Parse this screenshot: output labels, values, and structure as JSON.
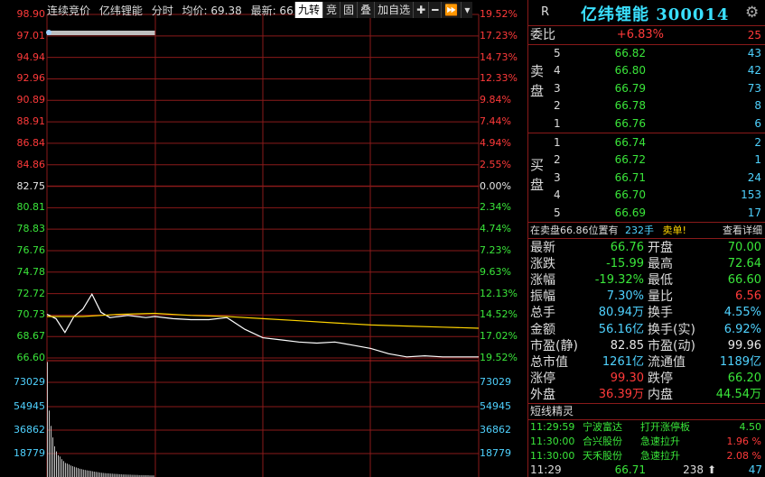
{
  "header": {
    "items": [
      "连续竞价",
      "亿纬锂能",
      "分时",
      "均价: 69.38",
      "最新: 66"
    ],
    "toolbar": [
      "九转",
      "竞",
      "固",
      "叠",
      "加自选",
      "✚",
      "━",
      "⏩",
      "▾"
    ]
  },
  "axis": {
    "left_price": [
      "98.90",
      "97.01",
      "94.94",
      "92.96",
      "90.89",
      "88.91",
      "86.84",
      "84.86",
      "82.75",
      "80.81",
      "78.83",
      "76.76",
      "74.78",
      "72.72",
      "70.73",
      "68.67",
      "66.60"
    ],
    "right_pct": [
      "19.52%",
      "17.23%",
      "14.73%",
      "12.33%",
      "9.84%",
      "7.44%",
      "4.94%",
      "2.55%",
      "0.00%",
      "2.34%",
      "4.74%",
      "7.23%",
      "9.63%",
      "12.13%",
      "14.52%",
      "17.02%",
      "19.52%"
    ],
    "volume": [
      "73029",
      "54945",
      "36862",
      "18779"
    ]
  },
  "chart_data": {
    "type": "line",
    "prev_close": 82.75,
    "ylim": [
      66.6,
      98.9
    ],
    "x_range_minutes": [
      0,
      240
    ],
    "series": [
      {
        "values_minute": [
          0,
          5,
          10,
          15,
          20,
          25,
          30,
          35,
          40,
          45,
          50,
          55,
          60,
          70,
          80,
          90,
          100,
          110,
          120,
          130,
          140,
          150,
          160,
          170,
          180,
          190,
          200,
          210,
          220,
          230,
          240
        ],
        "values": [
          70.7,
          70.3,
          69.0,
          70.5,
          71.2,
          72.6,
          70.9,
          70.4,
          70.5,
          70.6,
          70.5,
          70.4,
          70.5,
          70.3,
          70.2,
          70.2,
          70.4,
          69.3,
          68.5,
          68.3,
          68.1,
          68.0,
          68.1,
          67.8,
          67.5,
          67.0,
          66.7,
          66.8,
          66.7,
          66.7,
          66.7
        ]
      },
      {
        "values_minute": [
          0,
          20,
          40,
          60,
          80,
          100,
          120,
          140,
          160,
          180,
          200,
          220,
          240
        ],
        "values": [
          70.5,
          70.5,
          70.7,
          70.8,
          70.6,
          70.5,
          70.3,
          70.1,
          69.9,
          69.7,
          69.6,
          69.5,
          69.4
        ]
      }
    ],
    "volume_ylim": [
      0,
      91000
    ],
    "volume_bars": [
      90000,
      52000,
      40000,
      31000,
      24000,
      20000,
      17000,
      16000,
      14000,
      12500,
      11000,
      10500,
      9800,
      9000,
      8500,
      8000,
      7500,
      7000,
      6500,
      6200,
      5800,
      5500,
      5200,
      5000,
      4800,
      4500,
      4200,
      4000,
      3800,
      3500,
      3300,
      3200,
      3000,
      2900,
      2800,
      2700,
      2600,
      2500,
      2400,
      2300,
      2200,
      2100,
      2000,
      2000,
      1900,
      1800,
      1800,
      1700,
      1700,
      1600,
      1600,
      1500,
      1500,
      1500,
      1400,
      1400,
      1400,
      1300,
      1300,
      1300
    ]
  },
  "quote": {
    "r": "R",
    "title": "亿纬锂能 300014",
    "weibi": {
      "label": "委比",
      "pct": "+6.83%",
      "vol": "25"
    },
    "sell_label": [
      "卖",
      "盘"
    ],
    "buy_label": [
      "买",
      "盘"
    ],
    "sell": [
      {
        "lvl": "5",
        "price": "66.82",
        "vol": "43"
      },
      {
        "lvl": "4",
        "price": "66.80",
        "vol": "42"
      },
      {
        "lvl": "3",
        "price": "66.79",
        "vol": "73"
      },
      {
        "lvl": "2",
        "price": "66.78",
        "vol": "8"
      },
      {
        "lvl": "1",
        "price": "66.76",
        "vol": "6"
      }
    ],
    "buy": [
      {
        "lvl": "1",
        "price": "66.74",
        "vol": "2"
      },
      {
        "lvl": "2",
        "price": "66.72",
        "vol": "1"
      },
      {
        "lvl": "3",
        "price": "66.71",
        "vol": "24"
      },
      {
        "lvl": "4",
        "price": "66.70",
        "vol": "153"
      },
      {
        "lvl": "5",
        "price": "66.69",
        "vol": "17"
      }
    ],
    "info": {
      "a": "在卖盘66.86位置有",
      "b": "232手",
      "c": "卖单!",
      "d": "查看详细"
    },
    "stats": [
      {
        "l1": "最新",
        "v1": "66.76",
        "c1": "green",
        "l2": "开盘",
        "v2": "70.00",
        "c2": "green"
      },
      {
        "l1": "涨跌",
        "v1": "-15.99",
        "c1": "green",
        "l2": "最高",
        "v2": "72.64",
        "c2": "green"
      },
      {
        "l1": "涨幅",
        "v1": "-19.32%",
        "c1": "green",
        "l2": "最低",
        "v2": "66.60",
        "c2": "green"
      },
      {
        "l1": "振幅",
        "v1": "7.30%",
        "c1": "cyan",
        "l2": "量比",
        "v2": "6.56",
        "c2": "red"
      },
      {
        "l1": "总手",
        "v1": "80.94万",
        "c1": "cyan",
        "l2": "换手",
        "v2": "4.55%",
        "c2": "cyan"
      },
      {
        "l1": "金额",
        "v1": "56.16亿",
        "c1": "cyan",
        "l2": "换手(实)",
        "v2": "6.92%",
        "c2": "cyan"
      },
      {
        "l1": "市盈(静)",
        "v1": "82.85",
        "c1": "white",
        "l2": "市盈(动)",
        "v2": "99.96",
        "c2": "white"
      },
      {
        "l1": "总市值",
        "v1": "1261亿",
        "c1": "cyan",
        "l2": "流通值",
        "v2": "1189亿",
        "c2": "cyan"
      },
      {
        "l1": "涨停",
        "v1": "99.30",
        "c1": "red",
        "l2": "跌停",
        "v2": "66.20",
        "c2": "green"
      },
      {
        "l1": "外盘",
        "v1": "36.39万",
        "c1": "red",
        "l2": "内盘",
        "v2": "44.54万",
        "c2": "green"
      }
    ],
    "alerts_title": "短线精灵",
    "alerts": [
      {
        "time": "11:29:59",
        "name": "宁波富达",
        "event": "打开涨停板",
        "val": "4.50",
        "vc": "green"
      },
      {
        "time": "11:30:00",
        "name": "合兴股份",
        "event": "急速拉升",
        "val": "1.96 %",
        "vc": "red"
      },
      {
        "time": "11:30:00",
        "name": "天禾股份",
        "event": "急速拉升",
        "val": "2.08 %",
        "vc": "red"
      }
    ],
    "bottom": {
      "time": "11:29",
      "price": "66.71",
      "vol": "238",
      "arrow": "⬆",
      "n": "47"
    }
  },
  "colors": {
    "grid": "#8a1a1a",
    "price_line": "#ffffff",
    "avg_line": "#ffd400",
    "volume": "#c8c8c8",
    "accent": "#3ae0ff"
  }
}
